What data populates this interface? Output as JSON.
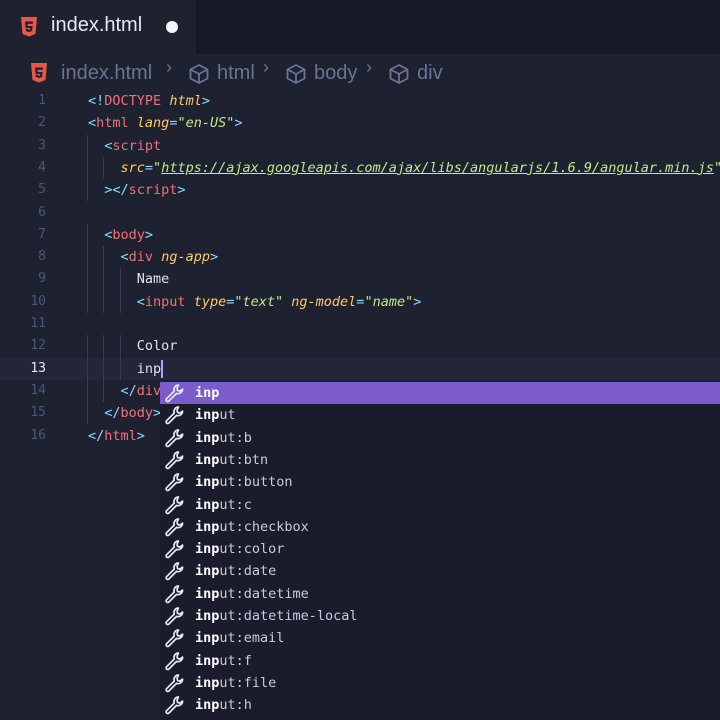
{
  "tab": {
    "title": "index.html",
    "icon": "html5-icon",
    "modified": true
  },
  "breadcrumb": [
    {
      "label": "index.html",
      "icon": "html5-icon"
    },
    {
      "label": "html",
      "icon": "cube-icon"
    },
    {
      "label": "body",
      "icon": "cube-icon"
    },
    {
      "label": "div",
      "icon": "cube-icon"
    }
  ],
  "editor": {
    "active_line": 13,
    "lines": [
      {
        "n": "1",
        "tokens": [
          [
            "pn",
            "<!"
          ],
          [
            "tg",
            "DOCTYPE"
          ],
          [
            "txt",
            " "
          ],
          [
            "at",
            "html"
          ],
          [
            "pn",
            ">"
          ]
        ],
        "indent": 0
      },
      {
        "n": "2",
        "tokens": [
          [
            "pn",
            "<"
          ],
          [
            "tg",
            "html"
          ],
          [
            "txt",
            " "
          ],
          [
            "at",
            "lang"
          ],
          [
            "pn",
            "="
          ],
          [
            "st",
            "\"en-US\""
          ],
          [
            "pn",
            ">"
          ]
        ],
        "indent": 0
      },
      {
        "n": "3",
        "tokens": [
          [
            "pn",
            "<"
          ],
          [
            "tg",
            "script"
          ]
        ],
        "indent": 1
      },
      {
        "n": "4",
        "tokens": [
          [
            "at",
            "src"
          ],
          [
            "pn",
            "="
          ],
          [
            "st",
            "\""
          ],
          [
            "url",
            "https://ajax.googleapis.com/ajax/libs/angularjs/1.6.9/angular.min.js"
          ],
          [
            "st",
            "\""
          ]
        ],
        "indent": 2
      },
      {
        "n": "5",
        "tokens": [
          [
            "pn",
            "></"
          ],
          [
            "tg",
            "script"
          ],
          [
            "pn",
            ">"
          ]
        ],
        "indent": 1
      },
      {
        "n": "6",
        "tokens": [],
        "indent": 0
      },
      {
        "n": "7",
        "tokens": [
          [
            "pn",
            "<"
          ],
          [
            "tg",
            "body"
          ],
          [
            "pn",
            ">"
          ]
        ],
        "indent": 1
      },
      {
        "n": "8",
        "tokens": [
          [
            "pn",
            "<"
          ],
          [
            "tg",
            "div"
          ],
          [
            "txt",
            " "
          ],
          [
            "at",
            "ng-app"
          ],
          [
            "pn",
            ">"
          ]
        ],
        "indent": 2
      },
      {
        "n": "9",
        "tokens": [
          [
            "txt",
            "Name"
          ]
        ],
        "indent": 3
      },
      {
        "n": "10",
        "tokens": [
          [
            "pn",
            "<"
          ],
          [
            "tg",
            "input"
          ],
          [
            "txt",
            " "
          ],
          [
            "at",
            "type"
          ],
          [
            "pn",
            "="
          ],
          [
            "st",
            "\"text\""
          ],
          [
            "txt",
            " "
          ],
          [
            "at",
            "ng-model"
          ],
          [
            "pn",
            "="
          ],
          [
            "st",
            "\"name\""
          ],
          [
            "pn",
            ">"
          ]
        ],
        "indent": 3
      },
      {
        "n": "11",
        "tokens": [],
        "indent": 0
      },
      {
        "n": "12",
        "tokens": [
          [
            "txt",
            "Color"
          ]
        ],
        "indent": 3
      },
      {
        "n": "13",
        "tokens": [
          [
            "txt",
            "inp"
          ]
        ],
        "indent": 3
      },
      {
        "n": "14",
        "tokens": [
          [
            "pn",
            "</"
          ],
          [
            "tg",
            "div"
          ]
        ],
        "indent": 2
      },
      {
        "n": "15",
        "tokens": [
          [
            "pn",
            "</"
          ],
          [
            "tg",
            "body"
          ],
          [
            "pn",
            ">"
          ]
        ],
        "indent": 1
      },
      {
        "n": "16",
        "tokens": [
          [
            "pn",
            "</"
          ],
          [
            "tg",
            "html"
          ],
          [
            "pn",
            ">"
          ]
        ],
        "indent": 0
      }
    ]
  },
  "suggestions": {
    "match": "inp",
    "selected_index": 0,
    "icon": "wrench-icon",
    "items": [
      "inp",
      "input",
      "input:b",
      "input:btn",
      "input:button",
      "input:c",
      "input:checkbox",
      "input:color",
      "input:date",
      "input:datetime",
      "input:datetime-local",
      "input:email",
      "input:f",
      "input:file",
      "input:h"
    ]
  }
}
